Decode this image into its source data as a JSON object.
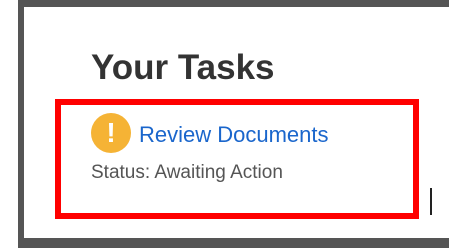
{
  "page": {
    "title": "Your Tasks"
  },
  "task": {
    "icon": "exclamation-alert-icon",
    "icon_glyph": "!",
    "link_label": "Review Documents",
    "status_text": "Status: Awaiting Action"
  },
  "colors": {
    "alert_icon": "#f5b335",
    "link": "#1a66cc",
    "highlight_border": "#ff0000"
  }
}
